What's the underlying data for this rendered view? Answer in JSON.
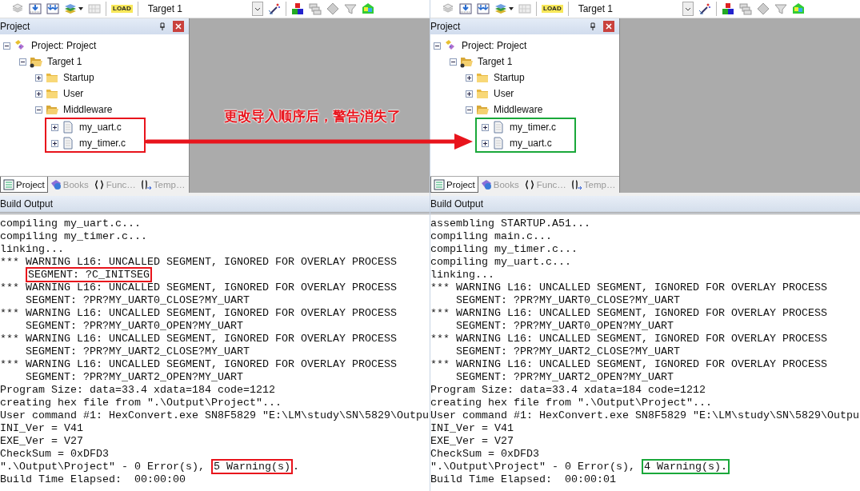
{
  "annotation": {
    "text": "更改导入顺序后，警告消失了",
    "color": "#e8141c"
  },
  "panels": [
    {
      "toolbar": {
        "load_label": "LOAD",
        "target": "Target 1"
      },
      "project_pane": {
        "title": "Project",
        "tree": [
          {
            "kind": "project",
            "label": "Project: Project",
            "expanded": true,
            "children": [
              {
                "kind": "target",
                "label": "Target 1",
                "expanded": true,
                "children": [
                  {
                    "kind": "folder",
                    "label": "Startup",
                    "expanded": false
                  },
                  {
                    "kind": "folder",
                    "label": "User",
                    "expanded": false
                  },
                  {
                    "kind": "folder",
                    "label": "Middleware",
                    "expanded": true,
                    "frame": {
                      "color": "#e8141c"
                    },
                    "children": [
                      {
                        "kind": "file",
                        "label": "my_uart.c",
                        "expanded": false
                      },
                      {
                        "kind": "file",
                        "label": "my_timer.c",
                        "expanded": false
                      }
                    ]
                  }
                ]
              }
            ]
          }
        ],
        "tabs": [
          {
            "kind": "project",
            "label": "Project",
            "selected": true
          },
          {
            "kind": "books",
            "label": "Books",
            "selected": false
          },
          {
            "kind": "functions",
            "label": "Func…",
            "selected": false
          },
          {
            "kind": "templates",
            "label": "Temp…",
            "selected": false
          }
        ]
      },
      "build_output": {
        "title": "Build Output",
        "lines": [
          [
            "compiling my_uart.c..."
          ],
          [
            "compiling my_timer.c..."
          ],
          [
            "linking..."
          ],
          [
            "*** WARNING L16: UNCALLED SEGMENT, IGNORED FOR OVERLAY PROCESS"
          ],
          [
            {
              "text": "SEGMENT: ?C_INITSEG",
              "color": "#e8141c",
              "indented": true
            }
          ],
          [
            "*** WARNING L16: UNCALLED SEGMENT, IGNORED FOR OVERLAY PROCESS"
          ],
          [
            "    SEGMENT: ?PR?MY_UART0_CLOSE?MY_UART"
          ],
          [
            "*** WARNING L16: UNCALLED SEGMENT, IGNORED FOR OVERLAY PROCESS"
          ],
          [
            "    SEGMENT: ?PR?MY_UART0_OPEN?MY_UART"
          ],
          [
            "*** WARNING L16: UNCALLED SEGMENT, IGNORED FOR OVERLAY PROCESS"
          ],
          [
            "    SEGMENT: ?PR?MY_UART2_CLOSE?MY_UART"
          ],
          [
            "*** WARNING L16: UNCALLED SEGMENT, IGNORED FOR OVERLAY PROCESS"
          ],
          [
            "    SEGMENT: ?PR?MY_UART2_OPEN?MY_UART"
          ],
          [
            "Program Size: data=33.4 xdata=184 code=1212"
          ],
          [
            "creating hex file from \".\\Output\\Project\"..."
          ],
          [
            "User command #1: HexConvert.exe SN8F5829 \"E:\\LM\\study\\SN\\5829\\Outpu"
          ],
          [
            "INI_Ver = V41"
          ],
          [
            "EXE_Ver = V27"
          ],
          [
            "CheckSum = 0xDFD3"
          ],
          [
            "\".\\Output\\Project\" - 0 Error(s), ",
            {
              "text": "5 Warning(s)",
              "color": "#e8141c"
            },
            "."
          ],
          [
            "Build Time Elapsed:  00:00:00"
          ]
        ]
      }
    },
    {
      "toolbar": {
        "load_label": "LOAD",
        "target": "Target 1"
      },
      "project_pane": {
        "title": "Project",
        "tree": [
          {
            "kind": "project",
            "label": "Project: Project",
            "expanded": true,
            "children": [
              {
                "kind": "target",
                "label": "Target 1",
                "expanded": true,
                "children": [
                  {
                    "kind": "folder",
                    "label": "Startup",
                    "expanded": false
                  },
                  {
                    "kind": "folder",
                    "label": "User",
                    "expanded": false
                  },
                  {
                    "kind": "folder",
                    "label": "Middleware",
                    "expanded": true,
                    "frame": {
                      "color": "#1aa83a"
                    },
                    "children": [
                      {
                        "kind": "file",
                        "label": "my_timer.c",
                        "expanded": false
                      },
                      {
                        "kind": "file",
                        "label": "my_uart.c",
                        "expanded": false
                      }
                    ]
                  }
                ]
              }
            ]
          }
        ],
        "tabs": [
          {
            "kind": "project",
            "label": "Project",
            "selected": true
          },
          {
            "kind": "books",
            "label": "Books",
            "selected": false
          },
          {
            "kind": "functions",
            "label": "Func…",
            "selected": false
          },
          {
            "kind": "templates",
            "label": "Temp…",
            "selected": false
          }
        ]
      },
      "build_output": {
        "title": "Build Output",
        "lines": [
          [
            "assembling STARTUP.A51..."
          ],
          [
            "compiling main.c..."
          ],
          [
            "compiling my_timer.c..."
          ],
          [
            "compiling my_uart.c..."
          ],
          [
            "linking..."
          ],
          [
            "*** WARNING L16: UNCALLED SEGMENT, IGNORED FOR OVERLAY PROCESS"
          ],
          [
            "    SEGMENT: ?PR?MY_UART0_CLOSE?MY_UART"
          ],
          [
            "*** WARNING L16: UNCALLED SEGMENT, IGNORED FOR OVERLAY PROCESS"
          ],
          [
            "    SEGMENT: ?PR?MY_UART0_OPEN?MY_UART"
          ],
          [
            "*** WARNING L16: UNCALLED SEGMENT, IGNORED FOR OVERLAY PROCESS"
          ],
          [
            "    SEGMENT: ?PR?MY_UART2_CLOSE?MY_UART"
          ],
          [
            "*** WARNING L16: UNCALLED SEGMENT, IGNORED FOR OVERLAY PROCESS"
          ],
          [
            "    SEGMENT: ?PR?MY_UART2_OPEN?MY_UART"
          ],
          [
            "Program Size: data=33.4 xdata=184 code=1212"
          ],
          [
            "creating hex file from \".\\Output\\Project\"..."
          ],
          [
            "User command #1: HexConvert.exe SN8F5829 \"E:\\LM\\study\\SN\\5829\\Outpu"
          ],
          [
            "INI_Ver = V41"
          ],
          [
            "EXE_Ver = V27"
          ],
          [
            "CheckSum = 0xDFD3"
          ],
          [
            "\".\\Output\\Project\" - 0 Error(s), ",
            {
              "text": "4 Warning(s).",
              "color": "#1aa83a"
            }
          ],
          [
            "Build Time Elapsed:  00:00:01"
          ]
        ]
      }
    }
  ]
}
